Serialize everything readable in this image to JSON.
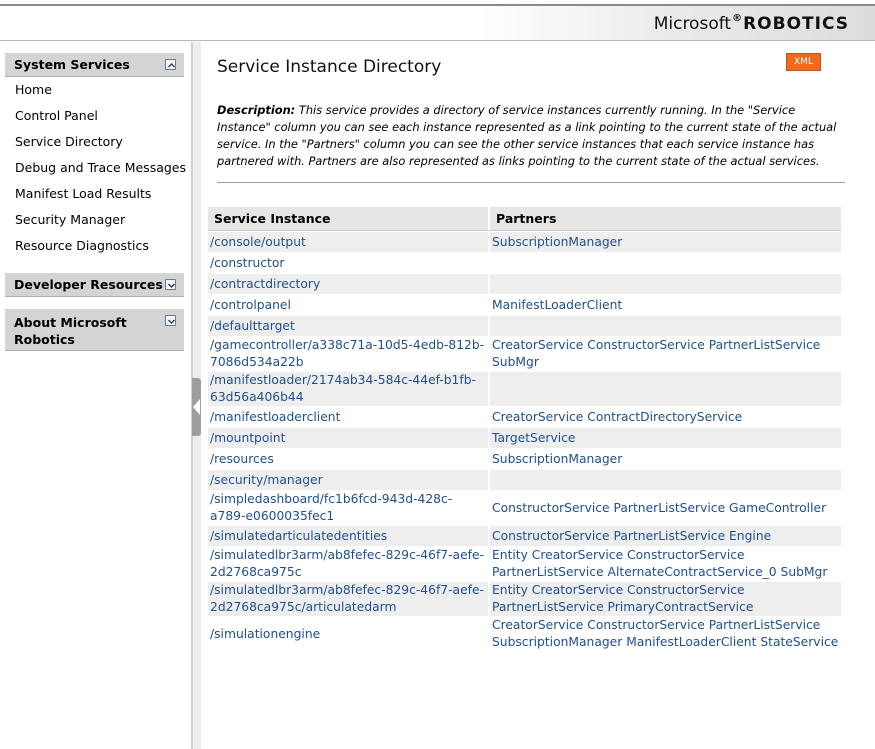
{
  "header": {
    "brand_microsoft": "Microsoft",
    "brand_reg": "®",
    "brand_robotics": "ROBOTICS"
  },
  "sidebar": {
    "sections": [
      {
        "title": "System Services",
        "expanded": true,
        "items": [
          "Home",
          "Control Panel",
          "Service Directory",
          "Debug and Trace Messages",
          "Manifest Load Results",
          "Security Manager",
          "Resource Diagnostics"
        ]
      },
      {
        "title": "Developer Resources",
        "expanded": false
      },
      {
        "title_line1": "About Microsoft",
        "title_line2": "Robotics",
        "expanded": false
      }
    ]
  },
  "main": {
    "title": "Service Instance Directory",
    "xml_button": "XML",
    "description_label": "Description:",
    "description_text": "This service provides a directory of service instances currently running. In the \"Service Instance\" column you can see each instance represented as a link pointing to the current state of the actual service. In the \"Partners\" column you can see the other service instances that each service instance has partnered with. Partners are also represented as links pointing to the current state of the actual services.",
    "table": {
      "headers": [
        "Service Instance",
        "Partners"
      ],
      "rows": [
        {
          "instance": "/console/output",
          "partners": "SubscriptionManager"
        },
        {
          "instance": "/constructor",
          "partners": ""
        },
        {
          "instance": "/contractdirectory",
          "partners": ""
        },
        {
          "instance": "/controlpanel",
          "partners": "ManifestLoaderClient"
        },
        {
          "instance": "/defaulttarget",
          "partners": ""
        },
        {
          "instance": "/gamecontroller/a338c71a-10d5-4edb-812b-7086d534a22b",
          "partners": "CreatorService ConstructorService PartnerListService SubMgr"
        },
        {
          "instance": "/manifestloader/2174ab34-584c-44ef-b1fb-63d56a406b44",
          "partners": ""
        },
        {
          "instance": "/manifestloaderclient",
          "partners": "CreatorService ContractDirectoryService"
        },
        {
          "instance": "/mountpoint",
          "partners": "TargetService"
        },
        {
          "instance": "/resources",
          "partners": "SubscriptionManager"
        },
        {
          "instance": "/security/manager",
          "partners": ""
        },
        {
          "instance": "/simpledashboard/fc1b6fcd-943d-428c-a789-e0600035fec1",
          "partners": "ConstructorService PartnerListService GameController"
        },
        {
          "instance": "/simulatedarticulatedentities",
          "partners": "ConstructorService PartnerListService Engine"
        },
        {
          "instance": "/simulatedlbr3arm/ab8fefec-829c-46f7-aefe-2d2768ca975c",
          "partners": "Entity CreatorService ConstructorService PartnerListService AlternateContractService_0 SubMgr"
        },
        {
          "instance": "/simulatedlbr3arm/ab8fefec-829c-46f7-aefe-2d2768ca975c/articulatedarm",
          "partners": "Entity CreatorService ConstructorService PartnerListService PrimaryContractService"
        },
        {
          "instance": "/simulationengine",
          "partners": "CreatorService ConstructorService PartnerListService SubscriptionManager ManifestLoaderClient StateService"
        }
      ]
    }
  },
  "colors": {
    "link": "#1f4f8f",
    "xml_button": "#ef6a1e",
    "section_header": "#d4d4d4",
    "row_alt": "#eeeeee"
  }
}
